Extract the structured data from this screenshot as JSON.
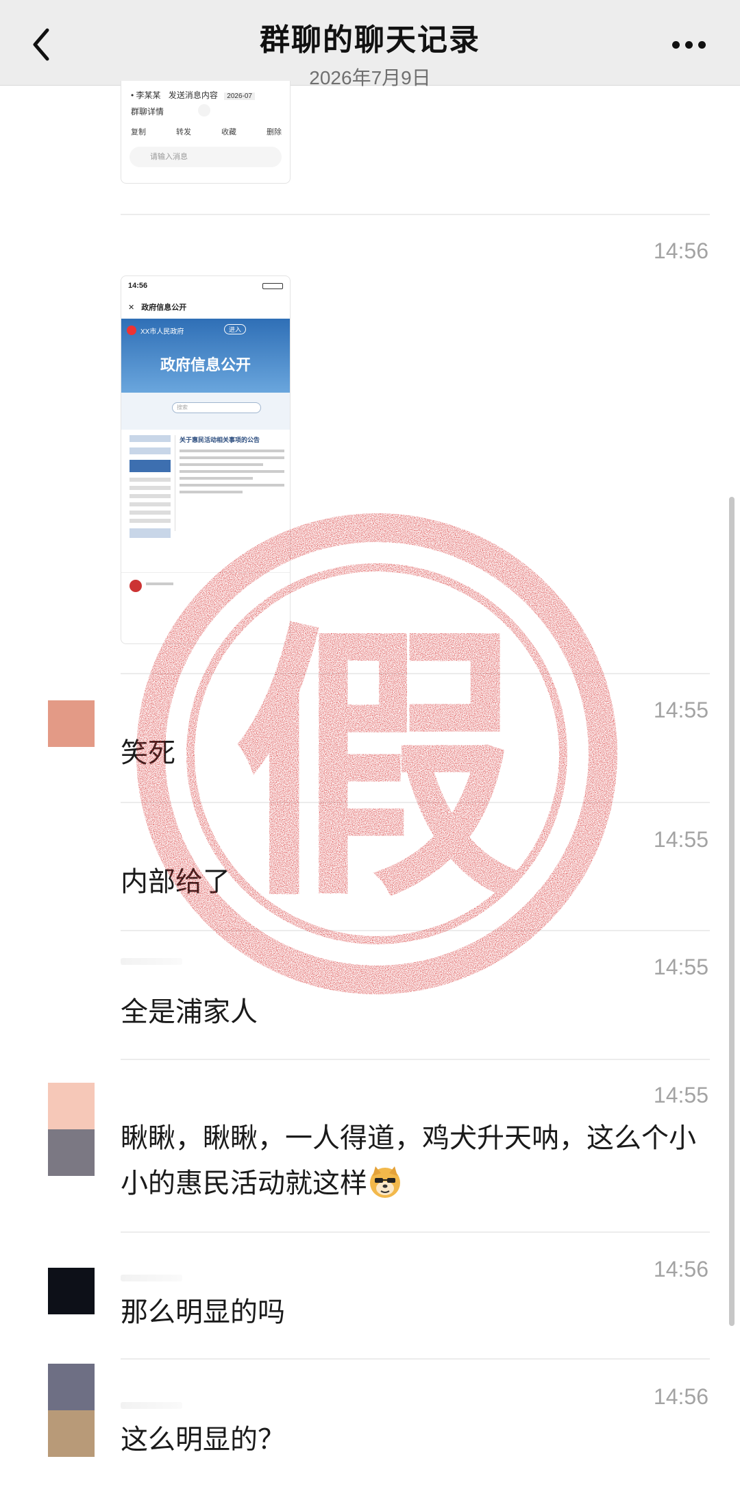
{
  "header": {
    "title": "群聊的聊天记录",
    "date": "2026年7月9日"
  },
  "thumb1": {
    "row1_a": "李某某",
    "row1_b": "发送消息内容",
    "row1_c": "2026-07",
    "row2": "群聊详情",
    "actions": [
      "复制",
      "转发",
      "收藏",
      "删除"
    ],
    "input_placeholder": "请输入消息"
  },
  "thumb2": {
    "status_time": "14:56",
    "nav_title": "政府信息公开",
    "banner_org": "XX市人民政府",
    "banner_btn": "进入",
    "banner_title": "政府信息公开",
    "search_placeholder": "搜索",
    "article_title": "关于惠民活动相关事项的公告"
  },
  "stamp": {
    "text": "假",
    "color": "#d42a2a"
  },
  "messages": [
    {
      "time": "14:56",
      "text": ""
    },
    {
      "time": "14:55",
      "text": "笑死"
    },
    {
      "time": "14:55",
      "text": "内部给了"
    },
    {
      "time": "14:55",
      "text": "全是浦家人"
    },
    {
      "time": "14:55",
      "text": "瞅瞅，瞅瞅，一人得道，鸡犬升天呐，这么个小小的惠民活动就这样"
    },
    {
      "time": "14:56",
      "text": "那么明显的吗"
    },
    {
      "time": "14:56",
      "text": "这么明显的？"
    }
  ]
}
